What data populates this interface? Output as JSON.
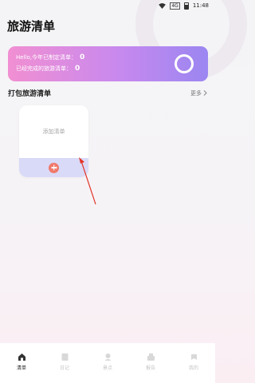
{
  "status_bar": {
    "time": "11:48",
    "badge": "4G"
  },
  "page": {
    "title": "旅游清单"
  },
  "banner": {
    "line1_label": "Hello,今年已制定清单：",
    "line1_value": "0",
    "line2_label": "已经完成的旅游清单：",
    "line2_value": "0"
  },
  "section": {
    "title": "打包旅游清单",
    "more_label": "更多",
    "more_icon": "chevron-right-icon"
  },
  "card": {
    "label": "添加清单",
    "add_icon": "plus-icon"
  },
  "tabs": [
    {
      "label": "清单",
      "icon": "home-icon",
      "active": true
    },
    {
      "label": "日记",
      "icon": "diary-icon",
      "active": false
    },
    {
      "label": "景点",
      "icon": "location-icon",
      "active": false
    },
    {
      "label": "报告",
      "icon": "report-icon",
      "active": false
    },
    {
      "label": "我的",
      "icon": "profile-icon",
      "active": false
    }
  ],
  "colors": {
    "banner_start": "#f18fd2",
    "banner_end": "#9b86f1",
    "add_button": "#f0796b",
    "annotation_arrow": "#e3362a"
  }
}
